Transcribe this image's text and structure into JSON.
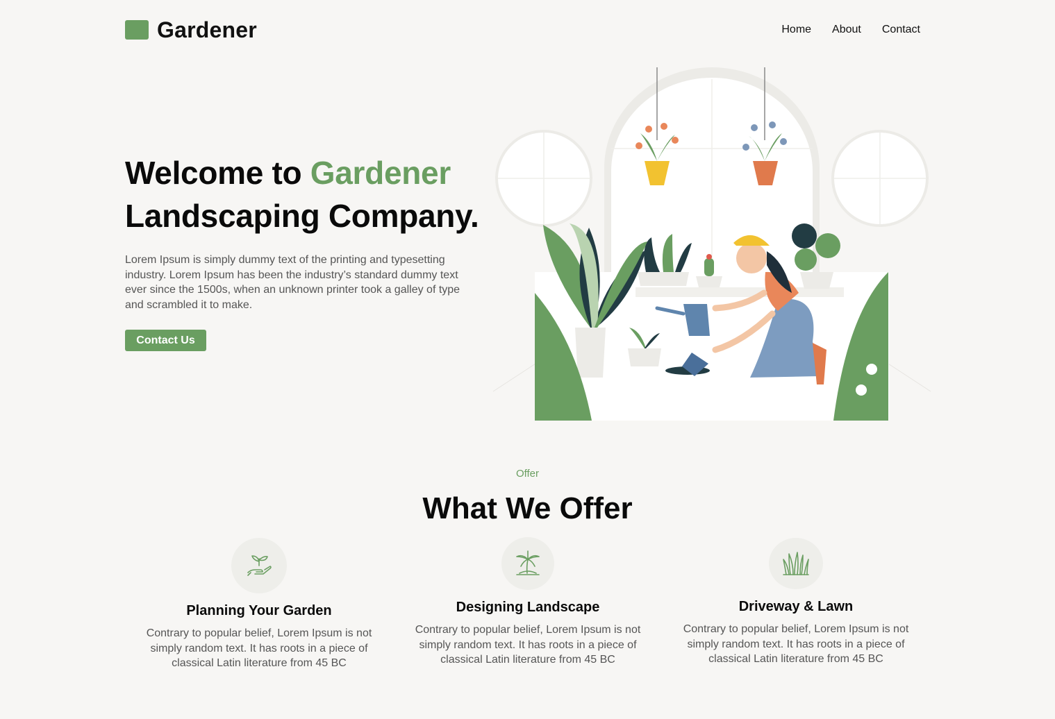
{
  "header": {
    "logo_text": "Gardener",
    "nav": [
      "Home",
      "About",
      "Contact"
    ]
  },
  "hero": {
    "title_part1": "Welcome to ",
    "title_accent": "Gardener",
    "title_line2": "Landscaping Company.",
    "description": "Lorem Ipsum is simply dummy text of the printing and typesetting industry. Lorem Ipsum has been the industry’s standard dummy text ever since the 1500s, when an unknown printer took a galley of type and scrambled it to make.",
    "cta_label": "Contact Us"
  },
  "offer": {
    "eyebrow": "Offer",
    "title": "What We Offer",
    "cards": [
      {
        "icon": "sprout-in-hand-icon",
        "title": "Planning Your Garden",
        "description": "Contrary to popular belief, Lorem Ipsum is not simply random text. It has roots in a piece of classical Latin literature from 45 BC"
      },
      {
        "icon": "palm-tree-icon",
        "title": "Designing Landscape",
        "description": "Contrary to popular belief, Lorem Ipsum is not simply random text. It has roots in a piece of classical Latin literature from 45 BC"
      },
      {
        "icon": "grass-icon",
        "title": "Driveway & Lawn",
        "description": "Contrary to popular belief, Lorem Ipsum is not simply random text. It has roots in a piece of classical Latin literature from 45 BC"
      }
    ]
  },
  "colors": {
    "accent": "#6a9e61",
    "background": "#f7f6f4",
    "icon_circle": "#eeeeea"
  }
}
